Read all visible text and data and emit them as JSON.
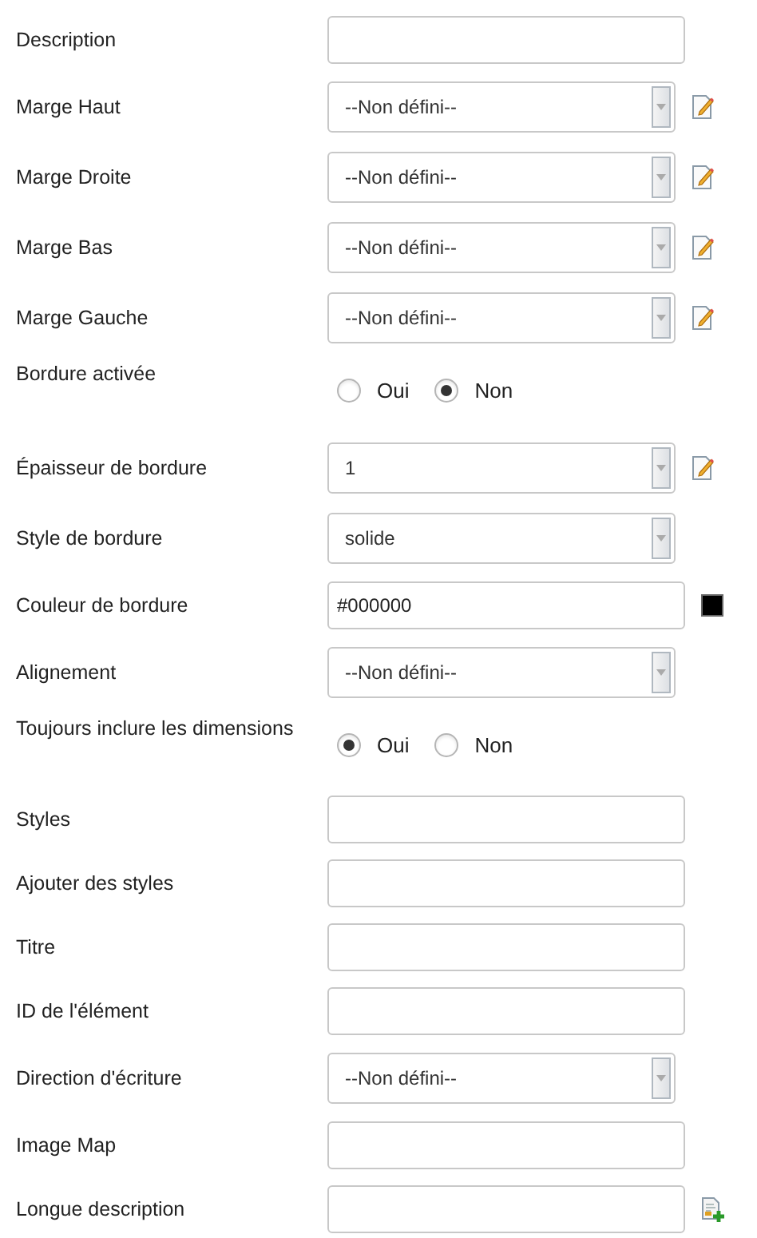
{
  "fields": [
    {
      "kind": "text",
      "label": "Description"
    },
    {
      "kind": "select_edit",
      "label": "Marge Haut",
      "value": "--Non défini--"
    },
    {
      "kind": "select_edit",
      "label": "Marge Droite",
      "value": "--Non défini--"
    },
    {
      "kind": "select_edit",
      "label": "Marge Bas",
      "value": "--Non défini--"
    },
    {
      "kind": "select_edit",
      "label": "Marge Gauche",
      "value": "--Non défini--"
    },
    {
      "kind": "radio",
      "label": "Bordure activée",
      "options": [
        {
          "label": "Oui",
          "selected": false
        },
        {
          "label": "Non",
          "selected": true
        }
      ]
    },
    {
      "kind": "select_edit",
      "label": "Épaisseur de bordure",
      "value": "1"
    },
    {
      "kind": "select",
      "label": "Style de bordure",
      "value": "solide"
    },
    {
      "kind": "color",
      "label": "Couleur de bordure",
      "value": "#000000",
      "color": "#000000"
    },
    {
      "kind": "select",
      "label": "Alignement",
      "value": "--Non défini--"
    },
    {
      "kind": "radio",
      "label": "Toujours inclure les dimensions",
      "options": [
        {
          "label": "Oui",
          "selected": true
        },
        {
          "label": "Non",
          "selected": false
        }
      ]
    },
    {
      "kind": "text",
      "label": "Styles"
    },
    {
      "kind": "text",
      "label": "Ajouter des styles"
    },
    {
      "kind": "text",
      "label": "Titre"
    },
    {
      "kind": "text",
      "label": "ID de l'élément"
    },
    {
      "kind": "select",
      "label": "Direction d'écriture",
      "value": "--Non défini--"
    },
    {
      "kind": "text",
      "label": "Image Map"
    },
    {
      "kind": "text_doc",
      "label": "Longue description"
    }
  ]
}
